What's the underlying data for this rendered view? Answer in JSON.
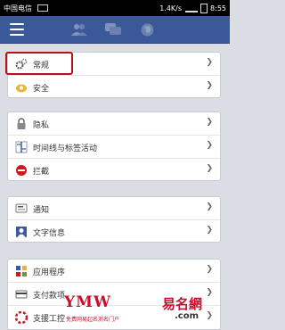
{
  "status_bar": {
    "carrier": "中国电信",
    "net_speed": "1.4K/s",
    "time": "8:55"
  },
  "header": {
    "menu_icon": "hamburger-menu-icon",
    "friends_icon": "friend-requests-icon",
    "messages_icon": "messages-icon",
    "notifications_icon": "globe-notifications-icon",
    "brand_color": "#3b5998"
  },
  "groups": [
    {
      "items": [
        {
          "label": "常规",
          "icon": "gear-icon"
        },
        {
          "label": "安全",
          "icon": "shield-icon"
        }
      ]
    },
    {
      "items": [
        {
          "label": "隐私",
          "icon": "lock-icon"
        },
        {
          "label": "时间线与标签活动",
          "icon": "timeline-icon"
        },
        {
          "label": "拦截",
          "icon": "block-icon"
        }
      ]
    },
    {
      "items": [
        {
          "label": "通知",
          "icon": "notifications-icon"
        },
        {
          "label": "文字信息",
          "icon": "text-message-icon"
        }
      ]
    },
    {
      "items": [
        {
          "label": "应用程序",
          "icon": "apps-icon"
        },
        {
          "label": "支付款项",
          "icon": "payments-icon"
        },
        {
          "label": "支援工控",
          "icon": "support-icon"
        }
      ]
    }
  ],
  "watermark": {
    "text": "YMW",
    "subtitle": "免费网易起名测名门户",
    "logo": "易名網",
    "domain": ".com"
  }
}
